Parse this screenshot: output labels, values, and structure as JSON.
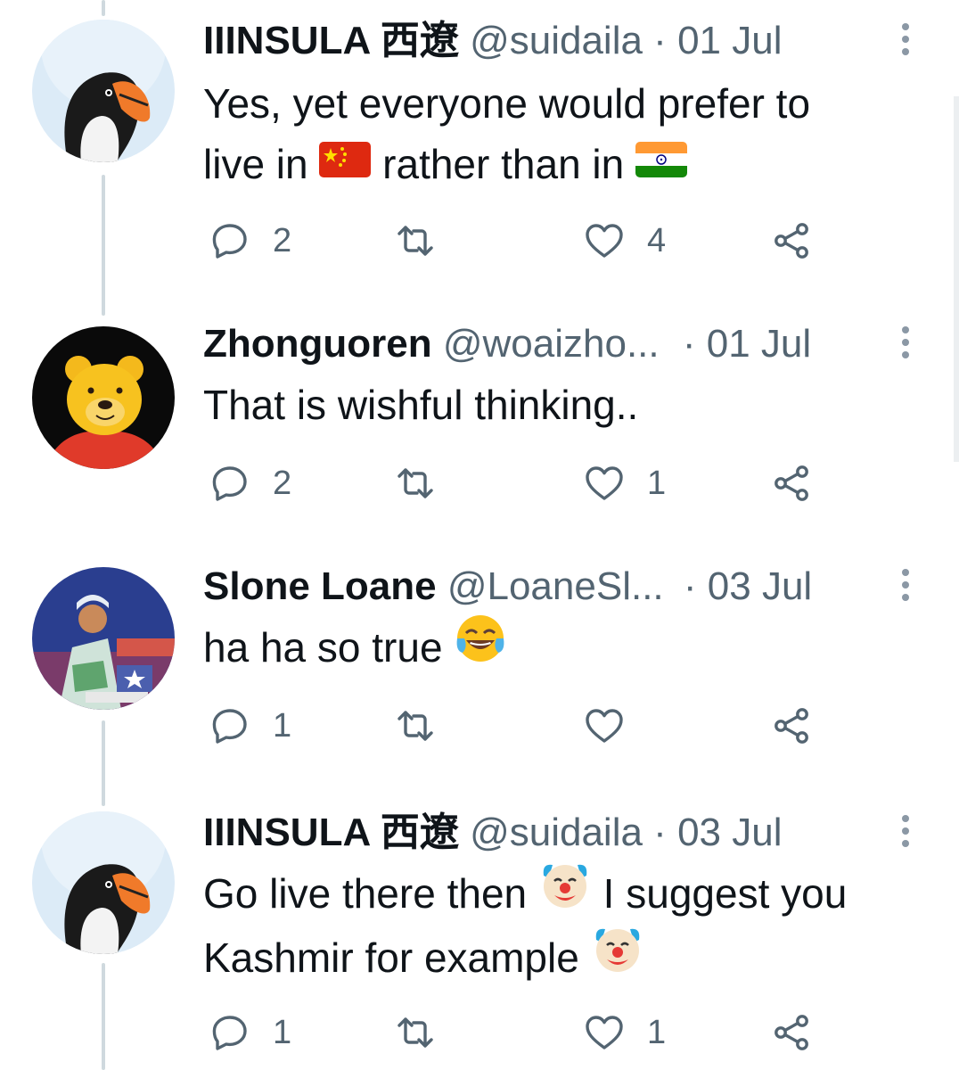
{
  "tweets": [
    {
      "name": "IIINSULA 西遼",
      "handle": "@suidaila",
      "dot": "·",
      "date": "01 Jul",
      "avatar": "puffin-avatar",
      "text_line1": "Yes, yet everyone would prefer to",
      "text_line2_a": "live in",
      "text_line2_b": "rather than in",
      "emoji_1": "flag-china-emoji",
      "emoji_2": "flag-india-emoji",
      "replies": "2",
      "retweets": "",
      "likes": "4"
    },
    {
      "name": "Zhonguoren",
      "handle": "@woaizho...",
      "dot": "·",
      "date": "01 Jul",
      "avatar": "winnie-the-pooh-avatar",
      "text_line1": "That is wishful thinking..",
      "replies": "2",
      "retweets": "",
      "likes": "1"
    },
    {
      "name": "Slone Loane",
      "handle": "@LoaneSl...",
      "dot": "·",
      "date": "03 Jul",
      "avatar": "anime-character-avatar",
      "text_line1": "ha ha so true",
      "emoji_1": "tears-of-joy-emoji",
      "replies": "1",
      "retweets": "",
      "likes": ""
    },
    {
      "name": "IIINSULA 西遼",
      "handle": "@suidaila",
      "dot": "·",
      "date": "03 Jul",
      "avatar": "puffin-avatar",
      "text_line1": "Go live there then",
      "text_line1_b": "I suggest you",
      "text_line2_a": "Kashmir for example",
      "emoji_1": "clown-face-emoji",
      "replies": "1",
      "retweets": "",
      "likes": "1"
    }
  ],
  "icons": {
    "reply": "reply-icon",
    "retweet": "retweet-icon",
    "like": "heart-icon",
    "share": "share-icon",
    "more": "more-vertical-icon"
  },
  "colors": {
    "text": "#0f1419",
    "secondary": "#536471",
    "thread_line": "#cfd9de",
    "icon": "#536471"
  }
}
